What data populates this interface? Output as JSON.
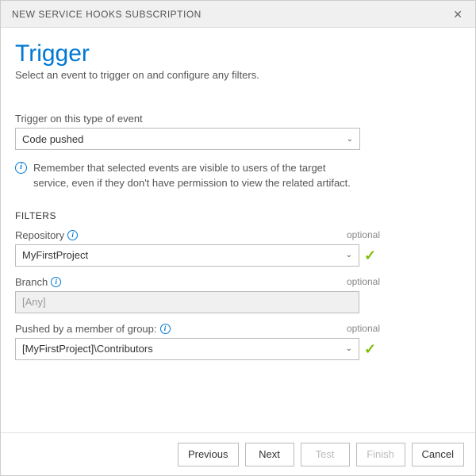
{
  "dialog": {
    "title": "NEW SERVICE HOOKS SUBSCRIPTION"
  },
  "page": {
    "heading": "Trigger",
    "subtitle": "Select an event to trigger on and configure any filters."
  },
  "event": {
    "label": "Trigger on this type of event",
    "value": "Code pushed",
    "note": "Remember that selected events are visible to users of the target service, even if they don't have permission to view the related artifact."
  },
  "filters": {
    "header": "FILTERS",
    "repository": {
      "label": "Repository",
      "optional": "optional",
      "value": "MyFirstProject"
    },
    "branch": {
      "label": "Branch",
      "optional": "optional",
      "value": "[Any]"
    },
    "group": {
      "label": "Pushed by a member of group:",
      "optional": "optional",
      "value": "[MyFirstProject]\\Contributors"
    }
  },
  "buttons": {
    "previous": "Previous",
    "next": "Next",
    "test": "Test",
    "finish": "Finish",
    "cancel": "Cancel"
  }
}
